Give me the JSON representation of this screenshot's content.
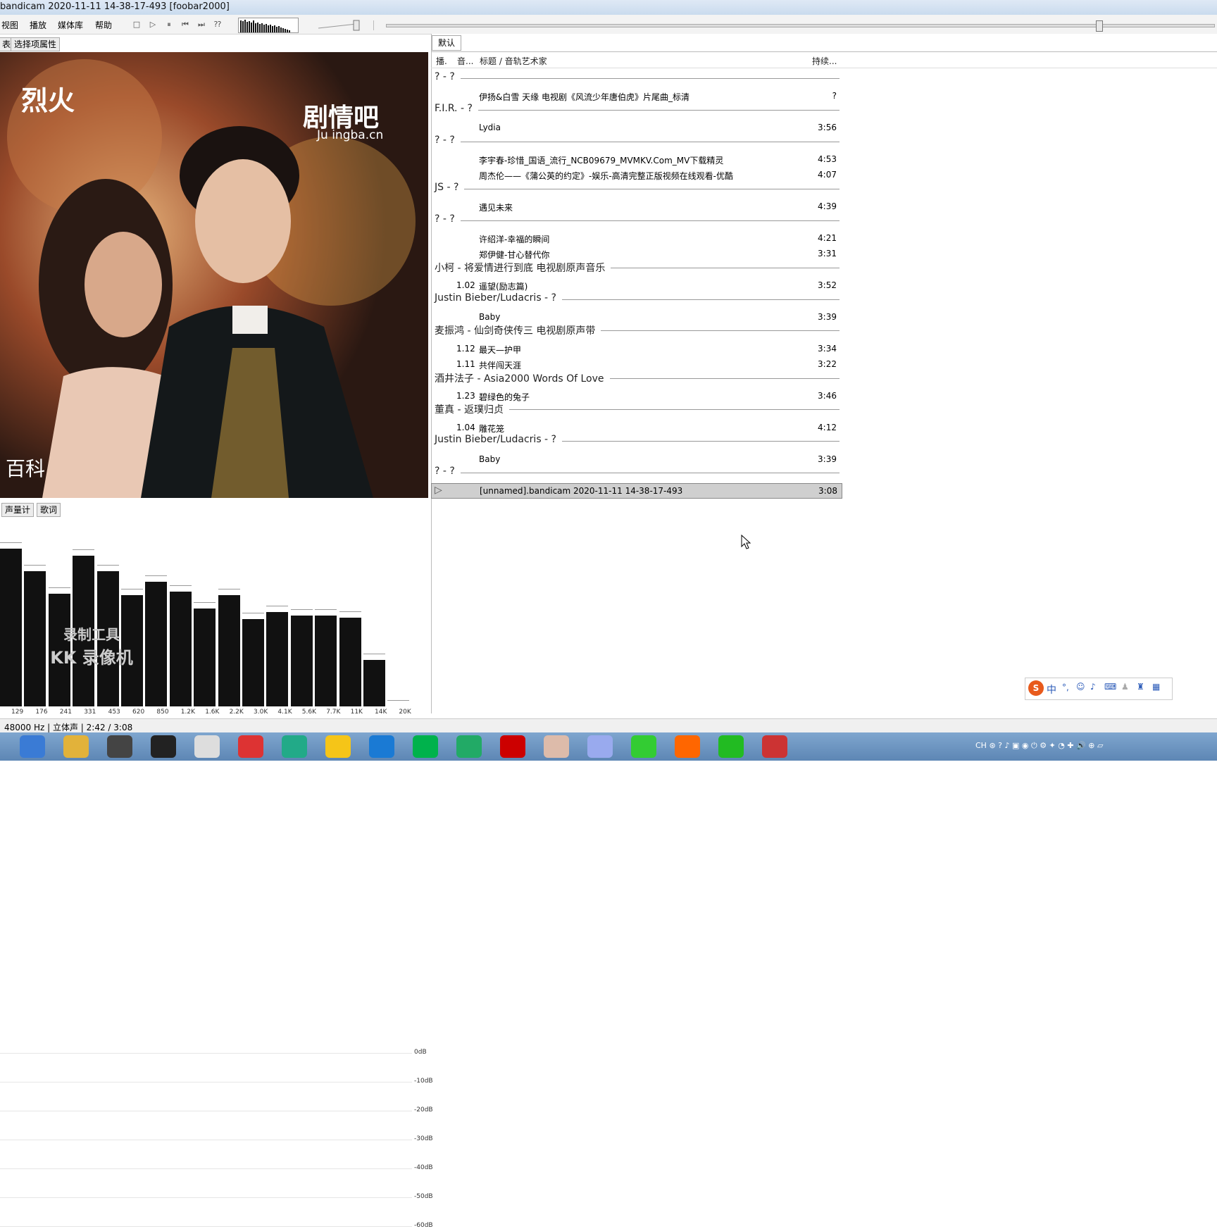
{
  "window": {
    "title": "bandicam 2020-11-11 14-38-17-493  [foobar2000]"
  },
  "menu": [
    "视图",
    "播放",
    "媒体库",
    "帮助"
  ],
  "left_tabs": {
    "top": [
      "表",
      "选择项属性"
    ],
    "bottom": [
      "声量计",
      "歌词"
    ]
  },
  "album_art": {
    "text1": "烈火",
    "logo": "剧情吧",
    "logo_sub": "Ju   ingba.cn",
    "corner": "百科"
  },
  "spectrum": {
    "db_labels": [
      "0dB",
      "-10dB",
      "-20dB",
      "-30dB",
      "-40dB",
      "-50dB",
      "-60dB"
    ],
    "freq_labels": [
      "129",
      "176",
      "241",
      "331",
      "453",
      "620",
      "850",
      "1.2K",
      "1.6K",
      "2.2K",
      "3.0K",
      "4.1K",
      "5.6K",
      "7.7K",
      "11K",
      "14K",
      "20K"
    ],
    "levels": [
      0.92,
      0.79,
      0.66,
      0.88,
      0.79,
      0.65,
      0.73,
      0.67,
      0.57,
      0.65,
      0.51,
      0.55,
      0.53,
      0.53,
      0.52,
      0.27,
      0.0
    ],
    "watermark": [
      "录制工具",
      "KK 录像机"
    ]
  },
  "playlist": {
    "tab": "默认",
    "columns": [
      "播.",
      "音...",
      "标题 / 音轨艺术家",
      "持续..."
    ],
    "rows": [
      {
        "type": "group",
        "text": "? - ?"
      },
      {
        "type": "track",
        "num": "",
        "title": "伊扬&白雪 天缘 电视剧《风流少年唐伯虎》片尾曲_标清",
        "dur": "?"
      },
      {
        "type": "group",
        "text": "F.I.R. - ?"
      },
      {
        "type": "track",
        "num": "",
        "title": "Lydia",
        "dur": "3:56"
      },
      {
        "type": "group",
        "text": "? - ?"
      },
      {
        "type": "track",
        "num": "",
        "title": "李宇春-珍惜_国语_流行_NCB09679_MVMKV.Com_MV下载精灵",
        "dur": "4:53"
      },
      {
        "type": "track",
        "num": "",
        "title": "周杰伦——《蒲公英的约定》-娱乐-高清完整正版视频在线观看-优酷",
        "dur": "4:07"
      },
      {
        "type": "group",
        "text": "JS - ?"
      },
      {
        "type": "track",
        "num": "",
        "title": "遇见未来",
        "dur": "4:39"
      },
      {
        "type": "group",
        "text": "? - ?"
      },
      {
        "type": "track",
        "num": "",
        "title": "许绍洋-幸福的瞬间",
        "dur": "4:21"
      },
      {
        "type": "track",
        "num": "",
        "title": "郑伊健-甘心替代你",
        "dur": "3:31"
      },
      {
        "type": "group",
        "text": "小柯 - 将爱情进行到底 电视剧原声音乐"
      },
      {
        "type": "track",
        "num": "1.02",
        "title": "遥望(励志篇)",
        "dur": "3:52"
      },
      {
        "type": "group",
        "text": "Justin Bieber/Ludacris - ?"
      },
      {
        "type": "track",
        "num": "",
        "title": "Baby",
        "dur": "3:39"
      },
      {
        "type": "group",
        "text": "麦振鸿 - 仙剑奇侠传三 电视剧原声带"
      },
      {
        "type": "track",
        "num": "1.12",
        "title": "最天—护甲",
        "dur": "3:34"
      },
      {
        "type": "track",
        "num": "1.11",
        "title": "共伴闯天涯",
        "dur": "3:22"
      },
      {
        "type": "group",
        "text": "酒井法子 - Asia2000 Words Of Love"
      },
      {
        "type": "track",
        "num": "1.23",
        "title": "碧绿色的兔子",
        "dur": "3:46"
      },
      {
        "type": "group",
        "text": "董真 - 返璞归贞"
      },
      {
        "type": "track",
        "num": "1.04",
        "title": "雕花笼",
        "dur": "4:12"
      },
      {
        "type": "group",
        "text": "Justin Bieber/Ludacris - ?"
      },
      {
        "type": "track",
        "num": "",
        "title": "Baby",
        "dur": "3:39"
      },
      {
        "type": "group",
        "text": "? - ?"
      },
      {
        "type": "track",
        "num": "",
        "title": "[unnamed].bandicam 2020-11-11 14-38-17-493",
        "dur": "3:08",
        "playing": true
      }
    ]
  },
  "status": {
    "text": "48000 Hz | 立体声 | 2:42 / 3:08"
  },
  "seek_progress": 0.86,
  "volume_level": 0.9,
  "taskbar": {
    "icons": [
      "search-icon",
      "explorer-icon",
      "video-editor-icon",
      "headphones-icon",
      "alien-icon",
      "netease-music-icon",
      "pinwheel-icon",
      "player-icon",
      "app-one-icon",
      "iqiyi-icon",
      "youku-icon",
      "flash-icon",
      "chrome-icon",
      "feather-icon",
      "play-icon",
      "firefox-icon",
      "green-app-icon",
      "bandicam-icon"
    ]
  },
  "ime": {
    "label": "中"
  }
}
